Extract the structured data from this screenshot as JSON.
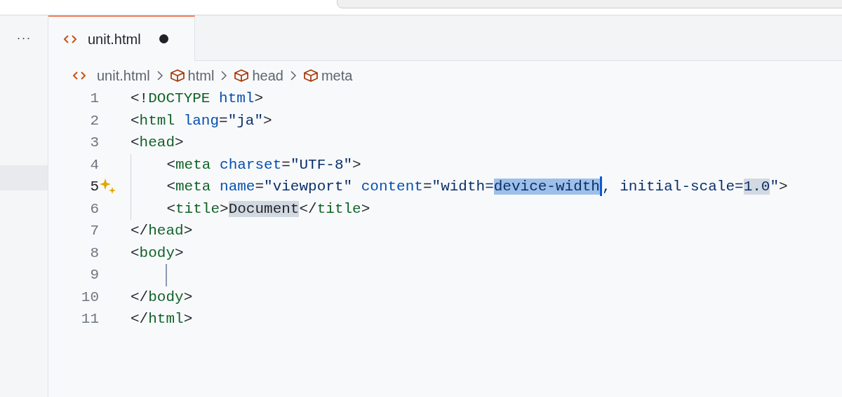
{
  "sidebar": {
    "more_label": "···"
  },
  "tab": {
    "label": "unit.html",
    "selected": true,
    "modified": true
  },
  "breadcrumbs": [
    {
      "label": "unit.html",
      "kind": "file"
    },
    {
      "label": "html",
      "kind": "element"
    },
    {
      "label": "head",
      "kind": "element"
    },
    {
      "label": "meta",
      "kind": "element"
    }
  ],
  "editor": {
    "lines": [
      {
        "number": "1",
        "current": false,
        "sparkle": false,
        "guide": false,
        "tokens": [
          {
            "text": "<!",
            "kind": "punct"
          },
          {
            "text": "DOCTYPE",
            "kind": "tag"
          },
          {
            "text": " html",
            "kind": "attr"
          },
          {
            "text": ">",
            "kind": "punct"
          }
        ]
      },
      {
        "number": "2",
        "current": false,
        "sparkle": false,
        "guide": false,
        "tokens": [
          {
            "text": "<",
            "kind": "punct"
          },
          {
            "text": "html",
            "kind": "tag"
          },
          {
            "text": " lang",
            "kind": "attr"
          },
          {
            "text": "=",
            "kind": "punct"
          },
          {
            "text": "\"ja\"",
            "kind": "str"
          },
          {
            "text": ">",
            "kind": "punct"
          }
        ]
      },
      {
        "number": "3",
        "current": false,
        "sparkle": false,
        "guide": false,
        "tokens": [
          {
            "text": "<",
            "kind": "punct"
          },
          {
            "text": "head",
            "kind": "tag"
          },
          {
            "text": ">",
            "kind": "punct"
          }
        ]
      },
      {
        "number": "4",
        "current": false,
        "sparkle": false,
        "guide": true,
        "tokens": [
          {
            "text": "    <",
            "kind": "punct"
          },
          {
            "text": "meta",
            "kind": "tag"
          },
          {
            "text": " charset",
            "kind": "attr"
          },
          {
            "text": "=",
            "kind": "punct"
          },
          {
            "text": "\"UTF-8\"",
            "kind": "str"
          },
          {
            "text": ">",
            "kind": "punct"
          }
        ]
      },
      {
        "number": "5",
        "current": true,
        "sparkle": true,
        "guide": true,
        "tokens": [
          {
            "text": "    <",
            "kind": "punct"
          },
          {
            "text": "meta",
            "kind": "tag"
          },
          {
            "text": " name",
            "kind": "attr"
          },
          {
            "text": "=",
            "kind": "punct"
          },
          {
            "text": "\"viewport\"",
            "kind": "str"
          },
          {
            "text": " content",
            "kind": "attr"
          },
          {
            "text": "=",
            "kind": "punct"
          },
          {
            "text": "\"width=",
            "kind": "str"
          },
          {
            "text": "device-width",
            "kind": "str",
            "selected": true,
            "caret_after": true
          },
          {
            "text": ", initial-scale=",
            "kind": "str"
          },
          {
            "text": "1.0",
            "kind": "str",
            "highlighted": true
          },
          {
            "text": "\"",
            "kind": "str"
          },
          {
            "text": ">",
            "kind": "punct"
          }
        ]
      },
      {
        "number": "6",
        "current": false,
        "sparkle": false,
        "guide": true,
        "tokens": [
          {
            "text": "    <",
            "kind": "punct"
          },
          {
            "text": "title",
            "kind": "tag"
          },
          {
            "text": ">",
            "kind": "punct"
          },
          {
            "text": "Document",
            "kind": "plain",
            "highlighted": true
          },
          {
            "text": "</",
            "kind": "punct"
          },
          {
            "text": "title",
            "kind": "tag"
          },
          {
            "text": ">",
            "kind": "punct"
          }
        ]
      },
      {
        "number": "7",
        "current": false,
        "sparkle": false,
        "guide": false,
        "tokens": [
          {
            "text": "</",
            "kind": "punct"
          },
          {
            "text": "head",
            "kind": "tag"
          },
          {
            "text": ">",
            "kind": "punct"
          }
        ]
      },
      {
        "number": "8",
        "current": false,
        "sparkle": false,
        "guide": false,
        "tokens": [
          {
            "text": "<",
            "kind": "punct"
          },
          {
            "text": "body",
            "kind": "tag"
          },
          {
            "text": ">",
            "kind": "punct"
          }
        ]
      },
      {
        "number": "9",
        "current": false,
        "sparkle": false,
        "guide": false,
        "active_guide": true
      },
      {
        "number": "10",
        "current": false,
        "sparkle": false,
        "guide": false,
        "tokens": [
          {
            "text": "</",
            "kind": "punct"
          },
          {
            "text": "body",
            "kind": "tag"
          },
          {
            "text": ">",
            "kind": "punct"
          }
        ]
      },
      {
        "number": "11",
        "current": false,
        "sparkle": false,
        "guide": false,
        "tokens": [
          {
            "text": "</",
            "kind": "punct"
          },
          {
            "text": "html",
            "kind": "tag"
          },
          {
            "text": ">",
            "kind": "punct"
          }
        ]
      }
    ]
  }
}
